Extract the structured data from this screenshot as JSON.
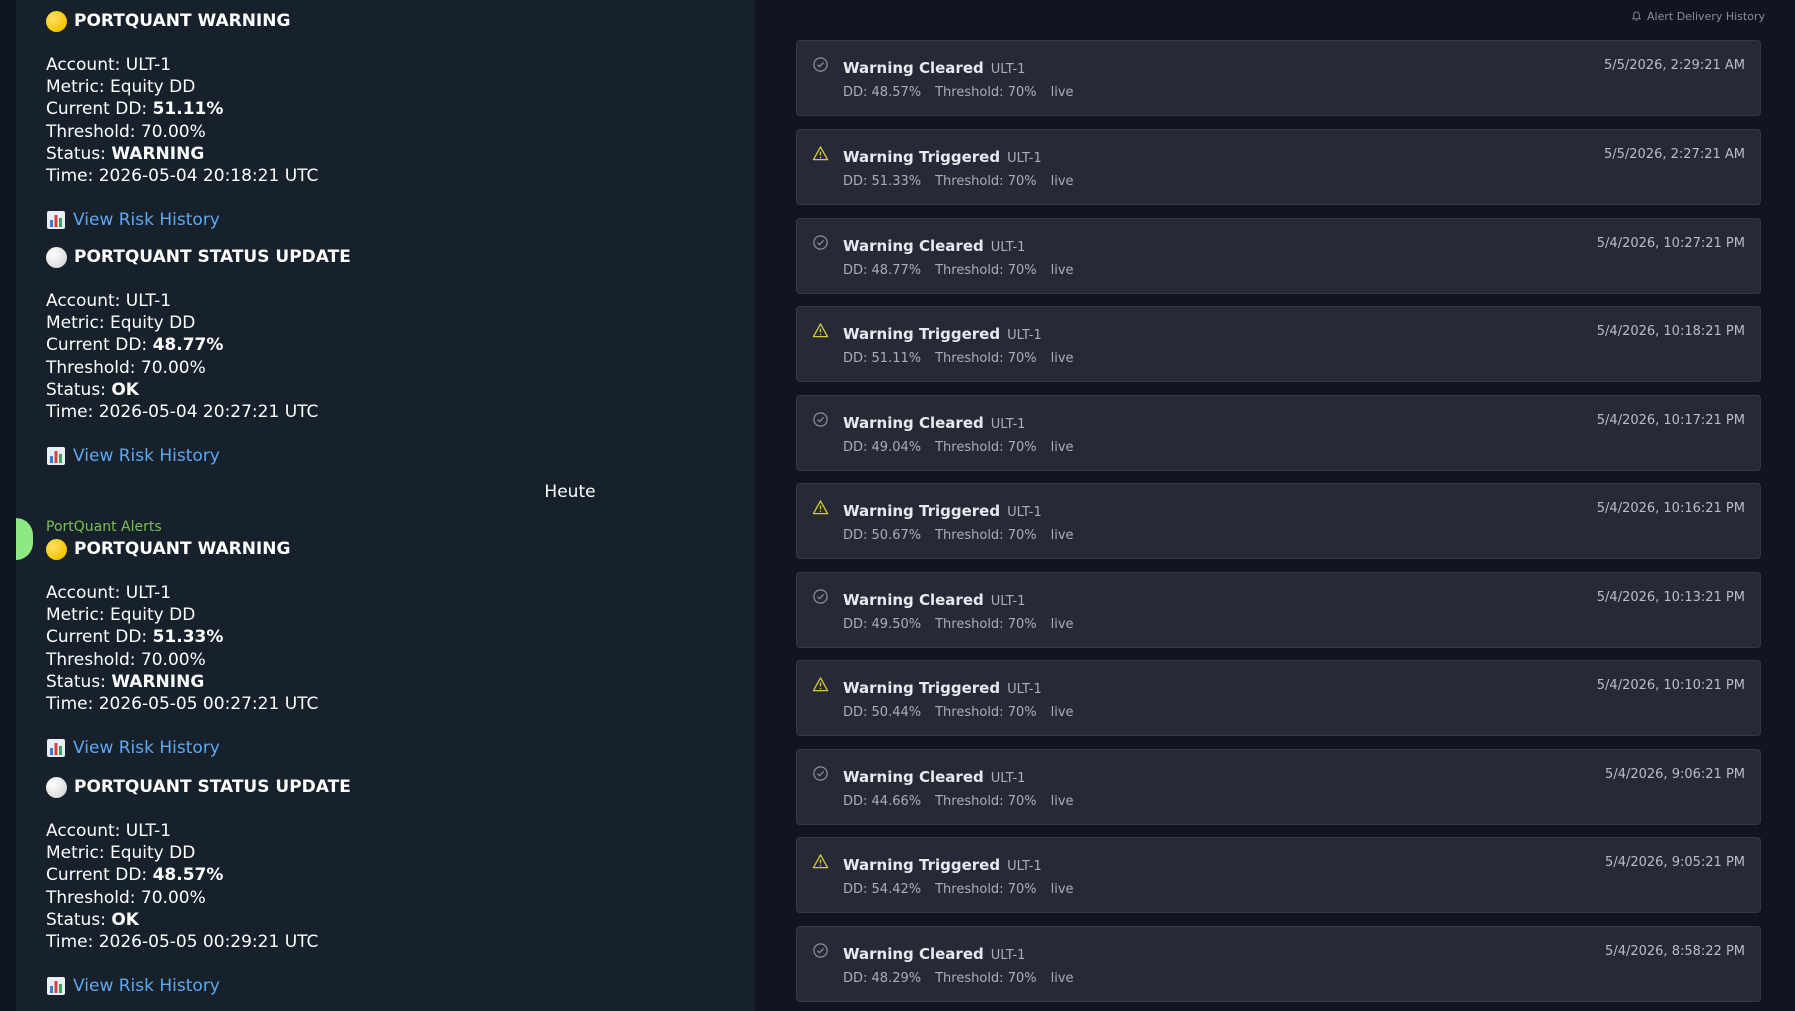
{
  "chat": {
    "messages": [
      {
        "title": "PORTQUANT WARNING",
        "icon": "yellow-circle",
        "account": "Account: ULT-1",
        "metric": "Metric: Equity DD",
        "dd_label": "Current DD: ",
        "dd_value": "51.11%",
        "threshold": "Threshold: 70.00%",
        "status_label": "Status: ",
        "status_value": "WARNING",
        "time": "Time: 2026-05-04 20:18:21 UTC",
        "link": "View Risk History"
      },
      {
        "title": "PORTQUANT STATUS UPDATE",
        "icon": "white-circle",
        "account": "Account: ULT-1",
        "metric": "Metric: Equity DD",
        "dd_label": "Current DD: ",
        "dd_value": "48.77%",
        "threshold": "Threshold: 70.00%",
        "status_label": "Status: ",
        "status_value": "OK",
        "time": "Time: 2026-05-04 20:27:21 UTC",
        "link": "View Risk History"
      },
      {
        "title": "PORTQUANT WARNING",
        "icon": "yellow-circle",
        "account": "Account: ULT-1",
        "metric": "Metric: Equity DD",
        "dd_label": "Current DD: ",
        "dd_value": "51.33%",
        "threshold": "Threshold: 70.00%",
        "status_label": "Status: ",
        "status_value": "WARNING",
        "time": "Time: 2026-05-05 00:27:21 UTC",
        "link": "View Risk History"
      },
      {
        "title": "PORTQUANT STATUS UPDATE",
        "icon": "white-circle",
        "account": "Account: ULT-1",
        "metric": "Metric: Equity DD",
        "dd_label": "Current DD: ",
        "dd_value": "48.57%",
        "threshold": "Threshold: 70.00%",
        "status_label": "Status: ",
        "status_value": "OK",
        "time": "Time: 2026-05-05 00:29:21 UTC",
        "link": "View Risk History"
      }
    ],
    "date_separator": "Heute",
    "sender_name": "PortQuant Alerts",
    "colors": {
      "sender": "#7bbf58",
      "link": "#5ea8f0",
      "avatar": "#8ee884"
    }
  },
  "delivery": {
    "title": "Alert Delivery History",
    "alerts": [
      {
        "type": "cleared",
        "title": "Warning Cleared",
        "account": "ULT-1",
        "dd": "DD: 48.57%",
        "threshold": "Threshold: 70%",
        "mode": "live",
        "time": "5/5/2026, 2:29:21 AM"
      },
      {
        "type": "triggered",
        "title": "Warning Triggered",
        "account": "ULT-1",
        "dd": "DD: 51.33%",
        "threshold": "Threshold: 70%",
        "mode": "live",
        "time": "5/5/2026, 2:27:21 AM"
      },
      {
        "type": "cleared",
        "title": "Warning Cleared",
        "account": "ULT-1",
        "dd": "DD: 48.77%",
        "threshold": "Threshold: 70%",
        "mode": "live",
        "time": "5/4/2026, 10:27:21 PM"
      },
      {
        "type": "triggered",
        "title": "Warning Triggered",
        "account": "ULT-1",
        "dd": "DD: 51.11%",
        "threshold": "Threshold: 70%",
        "mode": "live",
        "time": "5/4/2026, 10:18:21 PM"
      },
      {
        "type": "cleared",
        "title": "Warning Cleared",
        "account": "ULT-1",
        "dd": "DD: 49.04%",
        "threshold": "Threshold: 70%",
        "mode": "live",
        "time": "5/4/2026, 10:17:21 PM"
      },
      {
        "type": "triggered",
        "title": "Warning Triggered",
        "account": "ULT-1",
        "dd": "DD: 50.67%",
        "threshold": "Threshold: 70%",
        "mode": "live",
        "time": "5/4/2026, 10:16:21 PM"
      },
      {
        "type": "cleared",
        "title": "Warning Cleared",
        "account": "ULT-1",
        "dd": "DD: 49.50%",
        "threshold": "Threshold: 70%",
        "mode": "live",
        "time": "5/4/2026, 10:13:21 PM"
      },
      {
        "type": "triggered",
        "title": "Warning Triggered",
        "account": "ULT-1",
        "dd": "DD: 50.44%",
        "threshold": "Threshold: 70%",
        "mode": "live",
        "time": "5/4/2026, 10:10:21 PM"
      },
      {
        "type": "cleared",
        "title": "Warning Cleared",
        "account": "ULT-1",
        "dd": "DD: 44.66%",
        "threshold": "Threshold: 70%",
        "mode": "live",
        "time": "5/4/2026, 9:06:21 PM"
      },
      {
        "type": "triggered",
        "title": "Warning Triggered",
        "account": "ULT-1",
        "dd": "DD: 54.42%",
        "threshold": "Threshold: 70%",
        "mode": "live",
        "time": "5/4/2026, 9:05:21 PM"
      },
      {
        "type": "cleared",
        "title": "Warning Cleared",
        "account": "ULT-1",
        "dd": "DD: 48.29%",
        "threshold": "Threshold: 70%",
        "mode": "live",
        "time": "5/4/2026, 8:58:22 PM"
      }
    ],
    "colors": {
      "triggered_icon": "#d6c93a",
      "cleared_icon": "#8a909c",
      "card_bg": "#262a36"
    }
  }
}
